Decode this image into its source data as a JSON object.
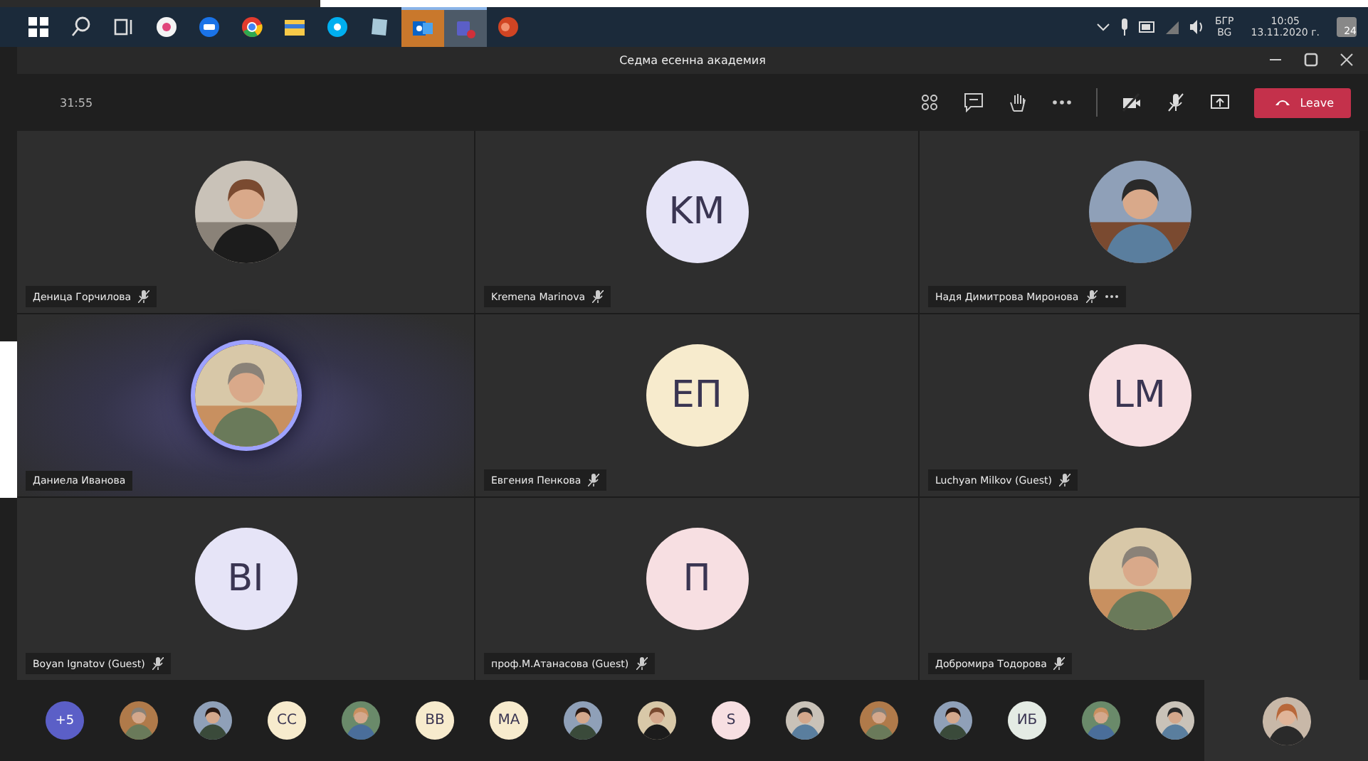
{
  "taskbar": {
    "apps": [
      {
        "kind": "start",
        "active": false
      },
      {
        "kind": "search",
        "active": false
      },
      {
        "kind": "taskview",
        "active": false
      },
      {
        "kind": "music",
        "active": false
      },
      {
        "kind": "remote",
        "active": false
      },
      {
        "kind": "browser",
        "active": false
      },
      {
        "kind": "folder",
        "active": false
      },
      {
        "kind": "skype",
        "active": false
      },
      {
        "kind": "notes",
        "active": false
      },
      {
        "kind": "mail",
        "active": true
      },
      {
        "kind": "teams",
        "active": true
      },
      {
        "kind": "slides",
        "active": false
      }
    ],
    "tray": {
      "language": "БГР",
      "layout": "BG",
      "time": "10:05",
      "date": "13.11.2020 г.",
      "notifications": "24"
    }
  },
  "window": {
    "title": "Седма есенна академия"
  },
  "toolbar": {
    "timer": "31:55",
    "leave": "Leave"
  },
  "tiles": [
    {
      "kind": "picture",
      "name": "Деница Горчилова",
      "muted": true,
      "more": false,
      "speaking": false
    },
    {
      "kind": "initials",
      "initials": "KM",
      "color": "#e6e4f7",
      "name": "Kremena Marinova",
      "muted": true,
      "more": false,
      "speaking": false
    },
    {
      "kind": "picture",
      "name": "Надя Димитрова Миронова",
      "muted": true,
      "more": true,
      "speaking": false
    },
    {
      "kind": "picture",
      "name": "Даниела Иванова",
      "muted": false,
      "more": false,
      "speaking": true
    },
    {
      "kind": "initials",
      "initials": "ЕП",
      "color": "#f7ebcd",
      "name": "Евгения Пенкова",
      "muted": true,
      "more": false,
      "speaking": false
    },
    {
      "kind": "initials",
      "initials": "LM",
      "color": "#f7dfe2",
      "name": "Luchyan Milkov (Guest)",
      "muted": true,
      "more": false,
      "speaking": false
    },
    {
      "kind": "initials",
      "initials": "BI",
      "color": "#e6e4f7",
      "name": "Boyan Ignatov (Guest)",
      "muted": true,
      "more": false,
      "speaking": false
    },
    {
      "kind": "initials",
      "initials": "П",
      "color": "#f7dfe2",
      "name": "проф.М.Атанасова (Guest)",
      "muted": true,
      "more": false,
      "speaking": false
    },
    {
      "kind": "picture",
      "name": "Добромира Тодорова",
      "muted": true,
      "more": false,
      "speaking": false
    }
  ],
  "roster": {
    "overflow": "+5",
    "people": [
      {
        "kind": "picture"
      },
      {
        "kind": "picture"
      },
      {
        "kind": "initials",
        "initials": "CC",
        "color": "#f7ebcd"
      },
      {
        "kind": "picture"
      },
      {
        "kind": "initials",
        "initials": "BB",
        "color": "#f7ebcd"
      },
      {
        "kind": "initials",
        "initials": "MA",
        "color": "#f7ebcd"
      },
      {
        "kind": "picture"
      },
      {
        "kind": "picture"
      },
      {
        "kind": "initials",
        "initials": "S",
        "color": "#f7dfe2"
      },
      {
        "kind": "picture"
      },
      {
        "kind": "picture"
      },
      {
        "kind": "picture"
      },
      {
        "kind": "initials",
        "initials": "ИБ",
        "color": "#e4ebe4"
      },
      {
        "kind": "picture"
      },
      {
        "kind": "picture"
      }
    ]
  },
  "self_view": {
    "kind": "picture"
  }
}
